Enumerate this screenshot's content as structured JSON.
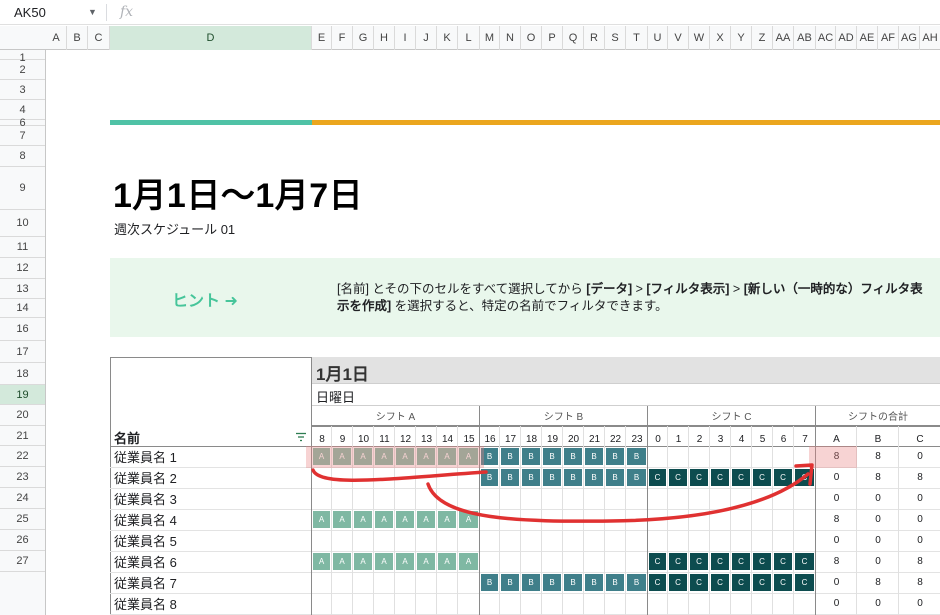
{
  "formula_bar": {
    "name_box": "AK50",
    "fx_label": "fx"
  },
  "columns": [
    "A",
    "B",
    "C",
    "D",
    "E",
    "F",
    "G",
    "H",
    "I",
    "J",
    "K",
    "L",
    "M",
    "N",
    "O",
    "P",
    "Q",
    "R",
    "S",
    "T",
    "U",
    "V",
    "W",
    "X",
    "Y",
    "Z",
    "AA",
    "AB",
    "AC",
    "AD",
    "AE",
    "AF",
    "AG",
    "AH"
  ],
  "selected_column": "D",
  "rows": [
    "1",
    "2",
    "3",
    "4",
    "6",
    "7",
    "8",
    "9",
    "10",
    "11",
    "12",
    "13",
    "14",
    "16",
    "17",
    "18",
    "19",
    "20",
    "21",
    "22",
    "23",
    "24",
    "25",
    "26",
    "27"
  ],
  "selected_row": "19",
  "title": "1月1日〜1月7日",
  "subtitle": "週次スケジュール 01",
  "hint": {
    "label": "ヒント ➜",
    "text_parts": [
      {
        "t": "[名前] とその下のセルをすべて選択してから ",
        "b": false
      },
      {
        "t": "[データ]",
        "b": true
      },
      {
        "t": " > ",
        "b": false
      },
      {
        "t": "[フィルタ表示]",
        "b": true
      },
      {
        "t": " > ",
        "b": false
      },
      {
        "t": "[新しい（一時的な）フィルタ表示を作成]",
        "b": true
      },
      {
        "t": " を選択すると、特定の名前でフィルタできます。",
        "b": false
      }
    ]
  },
  "schedule": {
    "date": "1月1日",
    "day_of_week": "日曜日",
    "groups": [
      "シフト A",
      "シフト B",
      "シフト C",
      "シフトの合計"
    ],
    "name_header": "名前",
    "hours": [
      "8",
      "9",
      "10",
      "11",
      "12",
      "13",
      "14",
      "15",
      "16",
      "17",
      "18",
      "19",
      "20",
      "21",
      "22",
      "23",
      "0",
      "1",
      "2",
      "3",
      "4",
      "5",
      "6",
      "7"
    ],
    "total_headers": [
      "A",
      "B",
      "C"
    ],
    "employees": [
      {
        "name": "従業員名 1",
        "a": 1,
        "b": 1,
        "c": 0,
        "totals": [
          "8",
          "8",
          "0"
        ]
      },
      {
        "name": "従業員名 2",
        "a": 0,
        "b": 1,
        "c": 1,
        "totals": [
          "0",
          "8",
          "8"
        ]
      },
      {
        "name": "従業員名 3",
        "a": 0,
        "b": 0,
        "c": 0,
        "totals": [
          "0",
          "0",
          "0"
        ]
      },
      {
        "name": "従業員名 4",
        "a": 1,
        "b": 0,
        "c": 0,
        "totals": [
          "8",
          "0",
          "0"
        ]
      },
      {
        "name": "従業員名 5",
        "a": 0,
        "b": 0,
        "c": 0,
        "totals": [
          "0",
          "0",
          "0"
        ]
      },
      {
        "name": "従業員名 6",
        "a": 1,
        "b": 0,
        "c": 1,
        "totals": [
          "8",
          "0",
          "8"
        ]
      },
      {
        "name": "従業員名 7",
        "a": 0,
        "b": 1,
        "c": 1,
        "totals": [
          "0",
          "8",
          "8"
        ]
      },
      {
        "name": "従業員名 8",
        "a": 0,
        "b": 0,
        "c": 0,
        "totals": [
          "0",
          "0",
          "0"
        ]
      }
    ],
    "shift_letters": {
      "a": "A",
      "b": "B",
      "c": "C"
    }
  },
  "colors": {
    "accent_teal": "#4fc2a6",
    "accent_orange": "#eba61e",
    "shift_a": "#7fb8a3",
    "shift_b": "#3f7f8a",
    "shift_c": "#0d4c4f",
    "annotation_red": "#e03131"
  }
}
